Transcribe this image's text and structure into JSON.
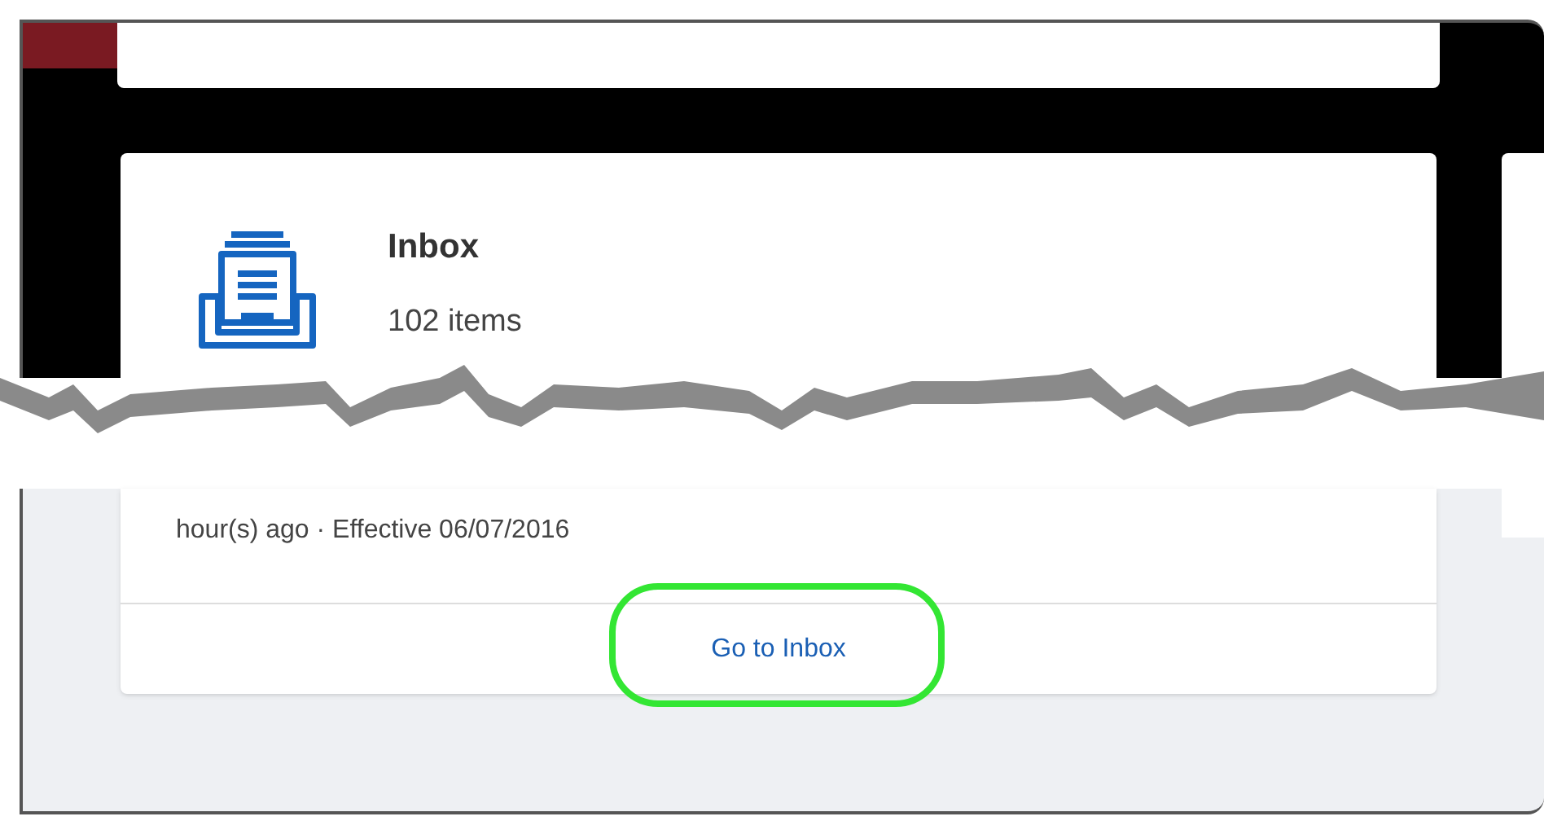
{
  "card": {
    "title": "Inbox",
    "count": "102 items",
    "meta": "hour(s) ago · Effective 06/07/2016",
    "link": "Go to Inbox",
    "link_highlighted": true
  }
}
